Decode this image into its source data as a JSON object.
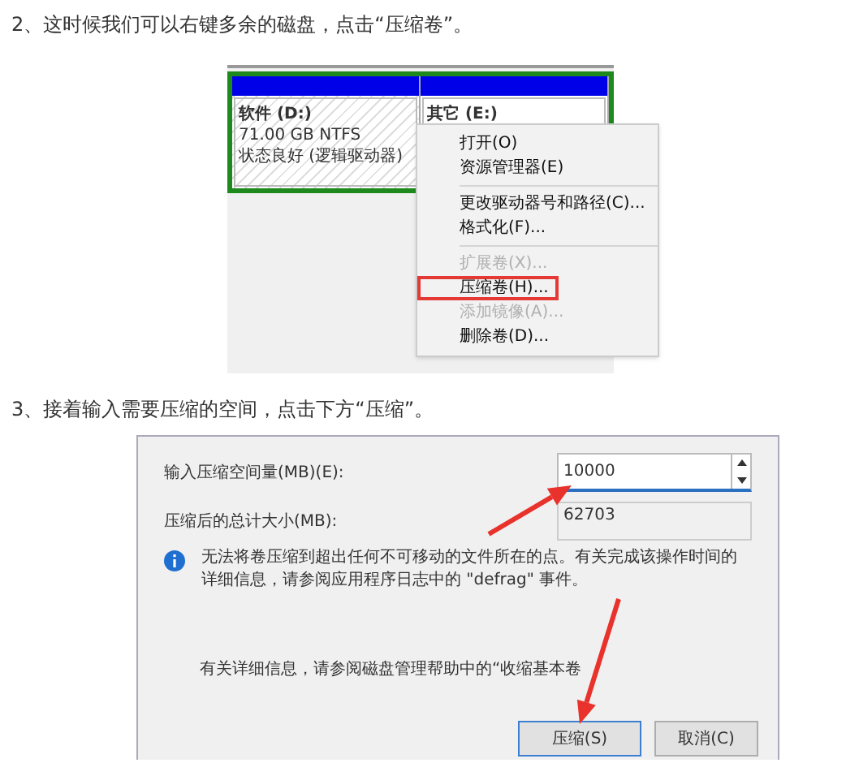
{
  "step_1": {
    "text": "2、这时候我们可以右键多余的磁盘，点击“压缩卷”。"
  },
  "disk_screenshot": {
    "partitions": [
      {
        "name": "软件 (D:)",
        "lines": [
          "71.00 GB NTFS",
          "状态良好 (逻辑驱动器)"
        ],
        "hatched": true
      },
      {
        "name": "其它 (E:)",
        "hatched": false
      }
    ],
    "context_menu": [
      {
        "kind": "item",
        "label": "打开(O)",
        "disabled": false,
        "highlighted": false
      },
      {
        "kind": "item",
        "label": "资源管理器(E)",
        "disabled": false,
        "highlighted": false
      },
      {
        "kind": "separator"
      },
      {
        "kind": "item",
        "label": "更改驱动器号和路径(C)...",
        "disabled": false,
        "highlighted": false
      },
      {
        "kind": "item",
        "label": "格式化(F)...",
        "disabled": false,
        "highlighted": false
      },
      {
        "kind": "separator"
      },
      {
        "kind": "item",
        "label": "扩展卷(X)...",
        "disabled": true,
        "highlighted": false
      },
      {
        "kind": "item",
        "label": "压缩卷(H)...",
        "disabled": false,
        "highlighted": true
      },
      {
        "kind": "item",
        "label": "添加镜像(A)...",
        "disabled": true,
        "highlighted": false
      },
      {
        "kind": "item",
        "label": "删除卷(D)...",
        "disabled": false,
        "highlighted": false
      }
    ]
  },
  "step_2": {
    "text": "3、接着输入需要压缩的空间，点击下方“压缩”。"
  },
  "shrink_dialog": {
    "fields": [
      {
        "label": "输入压缩空间量(MB)(E):",
        "value": "10000",
        "kind": "spin"
      },
      {
        "label": "压缩后的总计大小(MB):",
        "value": "62703",
        "kind": "readonly"
      }
    ],
    "info": "无法将卷压缩到超出任何不可移动的文件所在的点。有关完成该操作时间的详细信息，请参阅应用程序日志中的 \"defrag\" 事件。",
    "note": "有关详细信息，请参阅磁盘管理帮助中的“收缩基本卷",
    "buttons": [
      {
        "label": "压缩(S)",
        "default": true
      },
      {
        "label": "取消(C)",
        "default": false
      }
    ]
  }
}
